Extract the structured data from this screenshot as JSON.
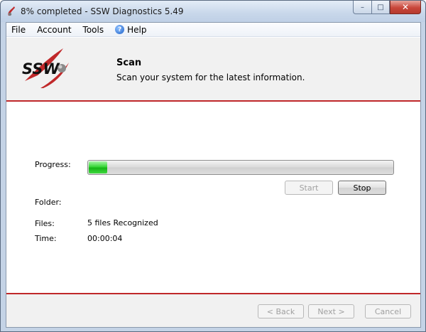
{
  "window": {
    "title": "8% completed - SSW Diagnostics 5.49",
    "controls": {
      "minimize": "–",
      "maximize": "□",
      "close": "✕"
    }
  },
  "menu": {
    "items": [
      "File",
      "Account",
      "Tools",
      "Help"
    ]
  },
  "header": {
    "logo_text": "SSW",
    "title": "Scan",
    "subtitle": "Scan your system for the latest information."
  },
  "scan": {
    "progress_label": "Progress:",
    "progress_fraction": 0.06,
    "start_label": "Start",
    "stop_label": "Stop",
    "folder_label": "Folder:",
    "folder_value": "",
    "files_label": "Files:",
    "files_value": "5 files Recognized",
    "time_label": "Time:",
    "time_value": "00:00:04"
  },
  "footer": {
    "back_label": "< Back",
    "next_label": "Next >",
    "cancel_label": "Cancel"
  },
  "colors": {
    "accent_red": "#c0282a",
    "progress_green": "#16b416"
  },
  "icons": {
    "app": "ssw-app-icon",
    "help": "help-icon",
    "logo": "ssw-logo"
  }
}
